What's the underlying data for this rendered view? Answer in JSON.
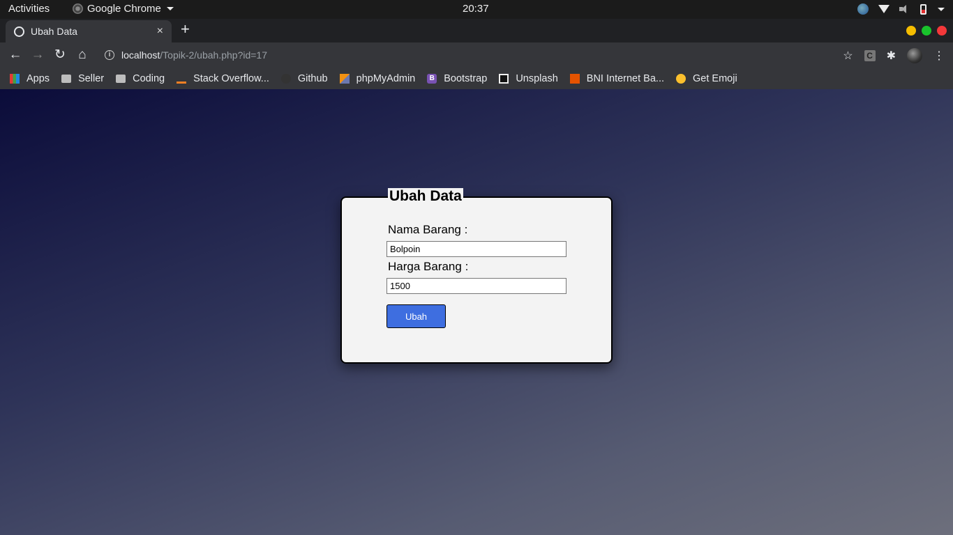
{
  "topbar": {
    "activities": "Activities",
    "app_name": "Google Chrome",
    "clock": "20:37"
  },
  "tab": {
    "title": "Ubah Data",
    "close": "×"
  },
  "new_tab": "+",
  "window_controls": {
    "minimize": "#f5bd00",
    "maximize": "#19c32c",
    "close": "#f4383a"
  },
  "toolbar": {
    "back": "←",
    "forward": "→",
    "reload": "↻",
    "home": "⌂",
    "url_host": "localhost",
    "url_path": "/Topik-2/ubah.php?id=17",
    "star": "☆",
    "extension_c": "C",
    "puzzle": "✱",
    "menu": "⋮"
  },
  "bookmarks": [
    {
      "label": "Apps",
      "icon": "apps-grid-icon"
    },
    {
      "label": "Seller",
      "icon": "folder-icon"
    },
    {
      "label": "Coding",
      "icon": "folder-icon"
    },
    {
      "label": "Stack Overflow...",
      "icon": "stackoverflow-icon"
    },
    {
      "label": "Github",
      "icon": "github-icon"
    },
    {
      "label": "phpMyAdmin",
      "icon": "phpmyadmin-icon"
    },
    {
      "label": "Bootstrap",
      "icon": "bootstrap-icon"
    },
    {
      "label": "Unsplash",
      "icon": "unsplash-icon"
    },
    {
      "label": "BNI Internet Ba...",
      "icon": "bni-icon"
    },
    {
      "label": "Get Emoji",
      "icon": "emoji-icon"
    }
  ],
  "form": {
    "legend": "Ubah Data",
    "nama_label": "Nama Barang :",
    "nama_value": "Bolpoin",
    "harga_label": "Harga Barang :",
    "harga_value": "1500",
    "submit_label": "Ubah",
    "button_color": "#3e6ee0"
  }
}
